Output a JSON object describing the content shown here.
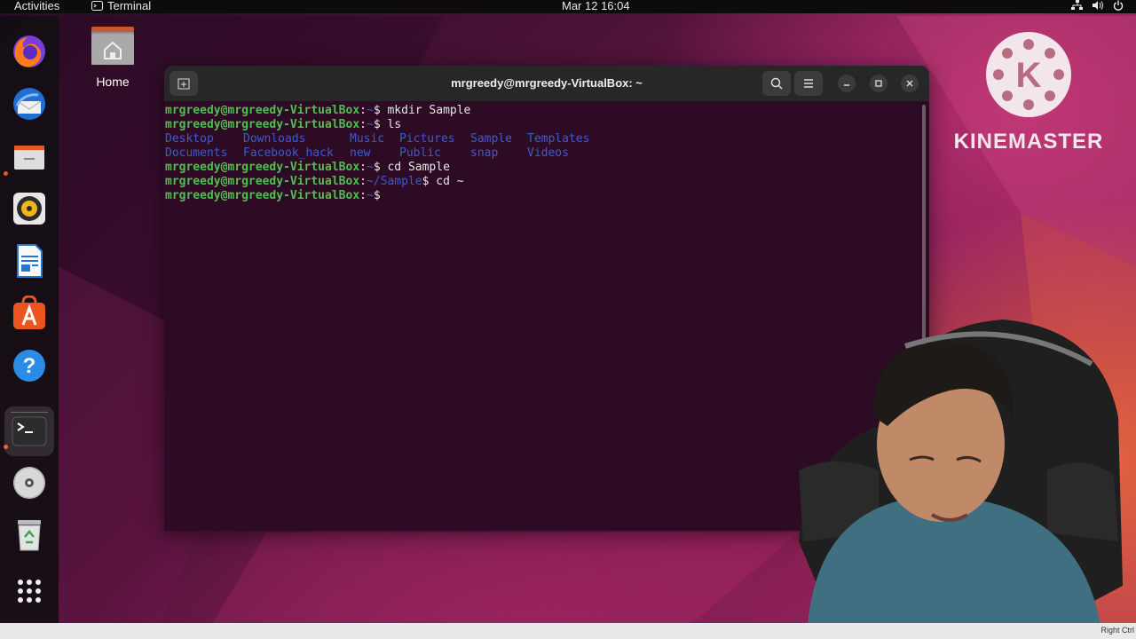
{
  "topbar": {
    "activities": "Activities",
    "app_name": "Terminal",
    "clock": "Mar 12  16:04"
  },
  "dock": {
    "items": [
      {
        "name": "firefox-icon"
      },
      {
        "name": "thunderbird-icon"
      },
      {
        "name": "files-icon"
      },
      {
        "name": "rhythmbox-icon"
      },
      {
        "name": "libreoffice-writer-icon"
      },
      {
        "name": "app-center-icon"
      },
      {
        "name": "help-icon"
      },
      {
        "name": "terminal-icon"
      },
      {
        "name": "dvd-icon"
      },
      {
        "name": "trash-icon"
      },
      {
        "name": "show-apps-icon"
      }
    ]
  },
  "desktop": {
    "home_label": "Home",
    "kinemaster_label": "KINEMASTER",
    "kinemaster_letter": "K"
  },
  "terminal": {
    "title": "mrgreedy@mrgreedy-VirtualBox: ~",
    "prompt_user": "mrgreedy@mrgreedy-VirtualBox",
    "lines": [
      {
        "path": "~",
        "cmd": " mkdir Sample"
      },
      {
        "path": "~",
        "cmd": " ls"
      },
      {
        "path": "~",
        "cmd": " cd Sample"
      },
      {
        "path": "~/Sample",
        "cmd": " cd ~"
      },
      {
        "path": "~",
        "cmd": ""
      }
    ],
    "ls_row1": [
      "Desktop",
      "Downloads",
      "Music",
      "Pictures",
      "Sample",
      "Templates"
    ],
    "ls_row2": [
      "Documents",
      "Facebook_hack",
      "new",
      "Public",
      "snap",
      "Videos"
    ]
  },
  "statusbar": {
    "host_key": "Right Ctrl"
  },
  "colors": {
    "prompt_green": "#4fbf4f",
    "dir_blue": "#3a5bd8",
    "terminal_bg": "#2d0b24",
    "accent_orange": "#e95420"
  }
}
